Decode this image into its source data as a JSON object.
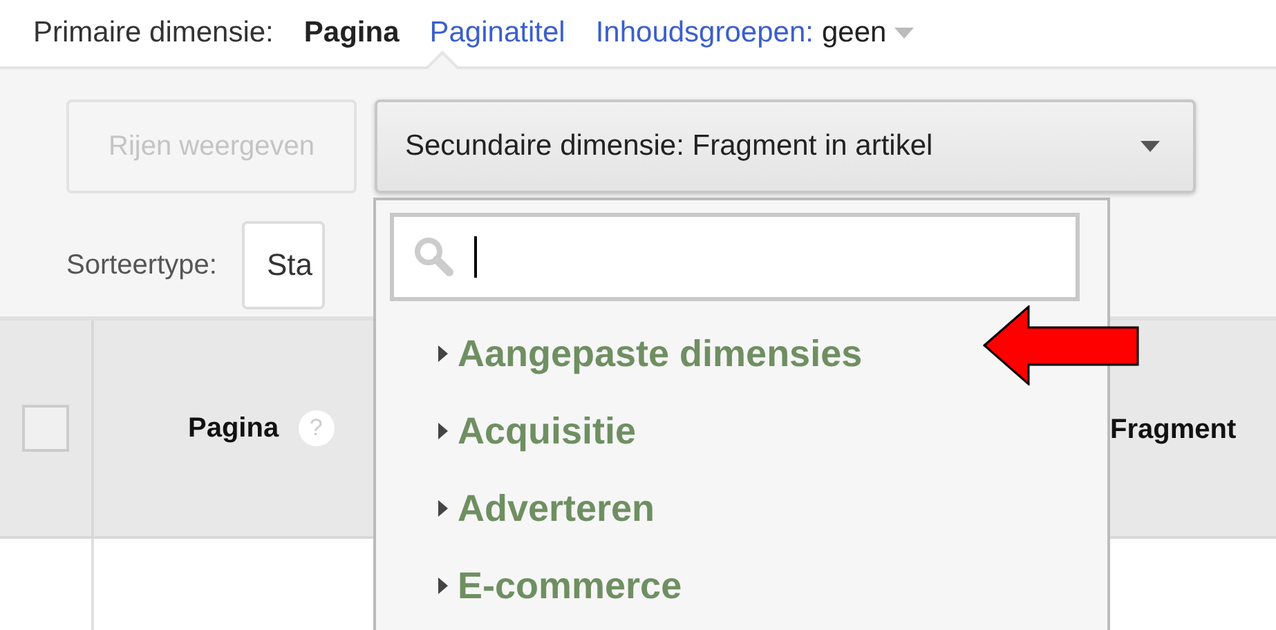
{
  "primary_dimension": {
    "label": "Primaire dimensie:",
    "options": [
      {
        "label": "Pagina",
        "selected": true
      },
      {
        "label": "Paginatitel",
        "selected": false
      }
    ],
    "content_groups": {
      "label": "Inhoudsgroepen:",
      "value": "geen"
    }
  },
  "toolbar": {
    "show_rows_button": {
      "label": "Rijen weergeven",
      "disabled": true
    },
    "secondary_dimension": {
      "label": "Secundaire dimensie: Fragment in artikel"
    }
  },
  "sort": {
    "label": "Sorteertype:",
    "value": "Sta"
  },
  "table": {
    "select_all_checked": false,
    "columns": [
      {
        "label": "Pagina",
        "help": "?"
      },
      {
        "label": "Fragment"
      }
    ]
  },
  "dropdown": {
    "items": [
      {
        "label": "Aangepaste dimensies",
        "expanded": false
      },
      {
        "label": "Acquisitie",
        "expanded": false
      },
      {
        "label": "Adverteren",
        "expanded": false
      },
      {
        "label": "E-commerce",
        "expanded": false
      }
    ]
  }
}
